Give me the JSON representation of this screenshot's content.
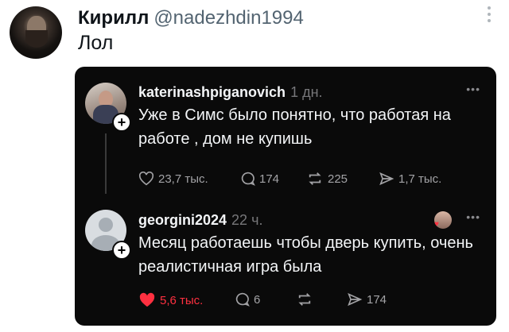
{
  "outer_post": {
    "display_name": "Кирилл",
    "handle": "@nadezhdin1994",
    "text": "Лол"
  },
  "thread": [
    {
      "username": "katerinashpiganovich",
      "time": "1 дн.",
      "text": "Уже в Симс было понятно, что работая на работе , дом не купишь",
      "likes": "23,7 тыс.",
      "comments": "174",
      "reposts": "225",
      "shares": "1,7 тыс."
    },
    {
      "username": "georgini2024",
      "time": "22 ч.",
      "text": "Месяц работаешь чтобы дверь купить, очень реалистичная игра была",
      "likes": "5,6 тыс.",
      "comments": "6",
      "shares": "174"
    }
  ],
  "colors": {
    "card_bg": "#0a0a0a",
    "like_red": "#ff3040",
    "muted": "#77777a"
  },
  "icons": [
    "more-vertical-icon",
    "heart-icon",
    "comment-icon",
    "repost-icon",
    "share-icon",
    "follow-plus-icon"
  ]
}
